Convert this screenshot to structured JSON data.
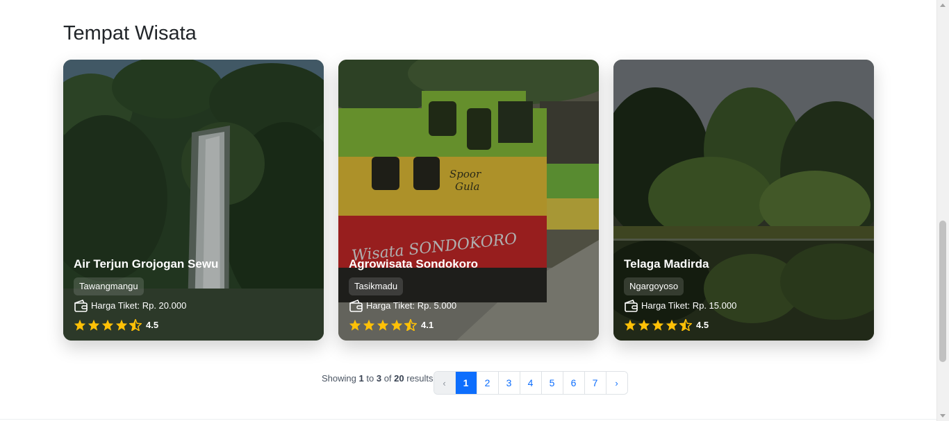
{
  "section": {
    "title": "Tempat Wisata"
  },
  "cards": [
    {
      "name": "Air Terjun Grojogan Sewu",
      "location": "Tawangmangu",
      "price": "Harga Tiket: Rp. 20.000",
      "rating": "4.5"
    },
    {
      "name": "Agrowisata Sondokoro",
      "location": "Tasikmadu",
      "price": "Harga Tiket: Rp. 5.000",
      "rating": "4.1"
    },
    {
      "name": "Telaga Madirda",
      "location": "Ngargoyoso",
      "price": "Harga Tiket: Rp. 15.000",
      "rating": "4.5"
    }
  ],
  "pagination": {
    "showing": "Showing",
    "from": "1",
    "to_word": "to",
    "to": "3",
    "of_word": "of",
    "total": "20",
    "results_word": "results",
    "prev": "‹",
    "next": "›",
    "pages": [
      "1",
      "2",
      "3",
      "4",
      "5",
      "6",
      "7"
    ],
    "current": "1"
  },
  "icons": {
    "wallet": "wallet-icon",
    "star": "star-icon",
    "half_star": "star-half-icon"
  },
  "colors": {
    "accent": "#0d6efd",
    "star": "#ffc107",
    "text": "#212529"
  }
}
